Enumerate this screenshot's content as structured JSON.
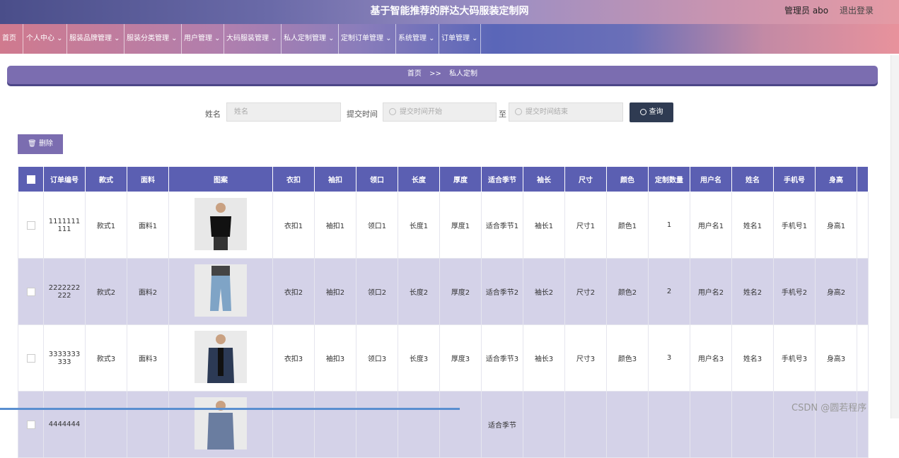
{
  "header": {
    "title": "基于智能推荐的胖达大码服装定制网",
    "admin": "管理员 abo",
    "logout": "退出登录"
  },
  "nav": [
    "首页",
    "个人中心 ⌄",
    "服装品牌管理 ⌄",
    "服装分类管理 ⌄",
    "用户管理 ⌄",
    "大码服装管理 ⌄",
    "私人定制管理 ⌄",
    "定制订单管理 ⌄",
    "系统管理 ⌄",
    "订单管理 ⌄"
  ],
  "breadcrumb": {
    "home": "首页",
    "sep": ">>",
    "current": "私人定制"
  },
  "search": {
    "name_label": "姓名",
    "name_placeholder": "姓名",
    "time_label": "提交时间",
    "start_placeholder": "提交时间开始",
    "to": "至",
    "end_placeholder": "提交时间结束",
    "query": "查询"
  },
  "delete_label": "删除",
  "table": {
    "headers": [
      "订单编号",
      "款式",
      "面料",
      "图案",
      "衣扣",
      "袖扣",
      "领口",
      "长度",
      "厚度",
      "适合季节",
      "袖长",
      "尺寸",
      "颜色",
      "定制数量",
      "用户名",
      "姓名",
      "手机号",
      "身高"
    ],
    "rows": [
      [
        "1111111111",
        "款式1",
        "面料1",
        "",
        "衣扣1",
        "袖扣1",
        "领口1",
        "长度1",
        "厚度1",
        "适合季节1",
        "袖长1",
        "尺寸1",
        "颜色1",
        "1",
        "用户名1",
        "姓名1",
        "手机号1",
        "身高1"
      ],
      [
        "2222222222",
        "款式2",
        "面料2",
        "",
        "衣扣2",
        "袖扣2",
        "领口2",
        "长度2",
        "厚度2",
        "适合季节2",
        "袖长2",
        "尺寸2",
        "颜色2",
        "2",
        "用户名2",
        "姓名2",
        "手机号2",
        "身高2"
      ],
      [
        "3333333333",
        "款式3",
        "面料3",
        "",
        "衣扣3",
        "袖扣3",
        "领口3",
        "长度3",
        "厚度3",
        "适合季节3",
        "袖长3",
        "尺寸3",
        "颜色3",
        "3",
        "用户名3",
        "姓名3",
        "手机号3",
        "身高3"
      ],
      [
        "4444444",
        "",
        "",
        "",
        "",
        "",
        "",
        "",
        "",
        "适合季节",
        "",
        "",
        "",
        "",
        "",
        "",
        "",
        ""
      ]
    ]
  },
  "watermark": "CSDN @圆若程序"
}
